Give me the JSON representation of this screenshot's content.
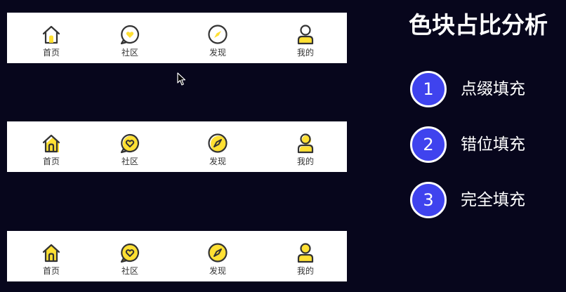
{
  "title": "色块占比分析",
  "colors": {
    "background": "#07061c",
    "badge": "#3f43ee",
    "fill_yellow": "#ffe033",
    "line_dark": "#333333",
    "tabbar": "#ffffff"
  },
  "tab_bars": [
    {
      "style": "dot-fill",
      "tabs": [
        {
          "label": "首页",
          "icon": "home-icon"
        },
        {
          "label": "社区",
          "icon": "chat-heart-icon"
        },
        {
          "label": "发现",
          "icon": "compass-icon"
        },
        {
          "label": "我的",
          "icon": "user-icon"
        }
      ]
    },
    {
      "style": "offset-fill",
      "tabs": [
        {
          "label": "首页",
          "icon": "home-icon"
        },
        {
          "label": "社区",
          "icon": "chat-heart-icon"
        },
        {
          "label": "发现",
          "icon": "compass-icon"
        },
        {
          "label": "我的",
          "icon": "user-icon"
        }
      ]
    },
    {
      "style": "full-fill",
      "tabs": [
        {
          "label": "首页",
          "icon": "home-icon"
        },
        {
          "label": "社区",
          "icon": "chat-heart-icon"
        },
        {
          "label": "发现",
          "icon": "compass-icon"
        },
        {
          "label": "我的",
          "icon": "user-icon"
        }
      ]
    }
  ],
  "items": [
    {
      "number": "1",
      "text": "点缀填充"
    },
    {
      "number": "2",
      "text": "错位填充"
    },
    {
      "number": "3",
      "text": "完全填充"
    }
  ]
}
